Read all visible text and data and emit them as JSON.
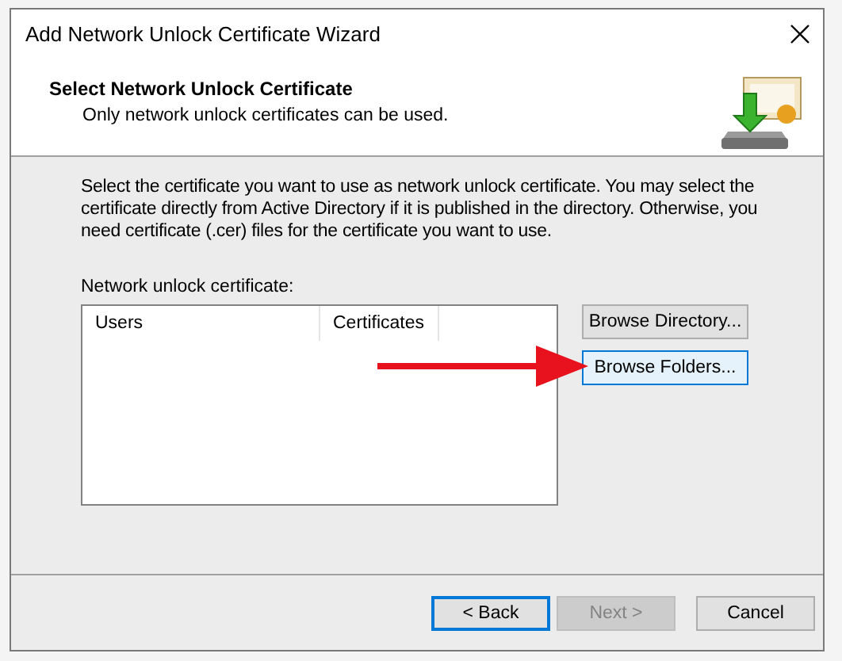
{
  "window": {
    "title": "Add Network Unlock Certificate Wizard"
  },
  "header": {
    "title": "Select Network Unlock Certificate",
    "subtitle": "Only network unlock certificates can be used."
  },
  "description": "Select the certificate you want to use as network unlock certificate. You may select the certificate directly from Active Directory if it is published in the directory. Otherwise, you need certificate (.cer) files for the certificate you want to use.",
  "list": {
    "label": "Network unlock certificate:",
    "columns": [
      "Users",
      "Certificates"
    ]
  },
  "side_buttons": [
    {
      "label": "Browse Directory...",
      "focused": false
    },
    {
      "label": "Browse Folders...",
      "focused": true
    }
  ],
  "nav_buttons": [
    {
      "label": "< Back",
      "disabled": false,
      "default": true
    },
    {
      "label": "Next >",
      "disabled": true,
      "default": false
    },
    {
      "label": "Cancel",
      "disabled": false,
      "default": false
    }
  ]
}
